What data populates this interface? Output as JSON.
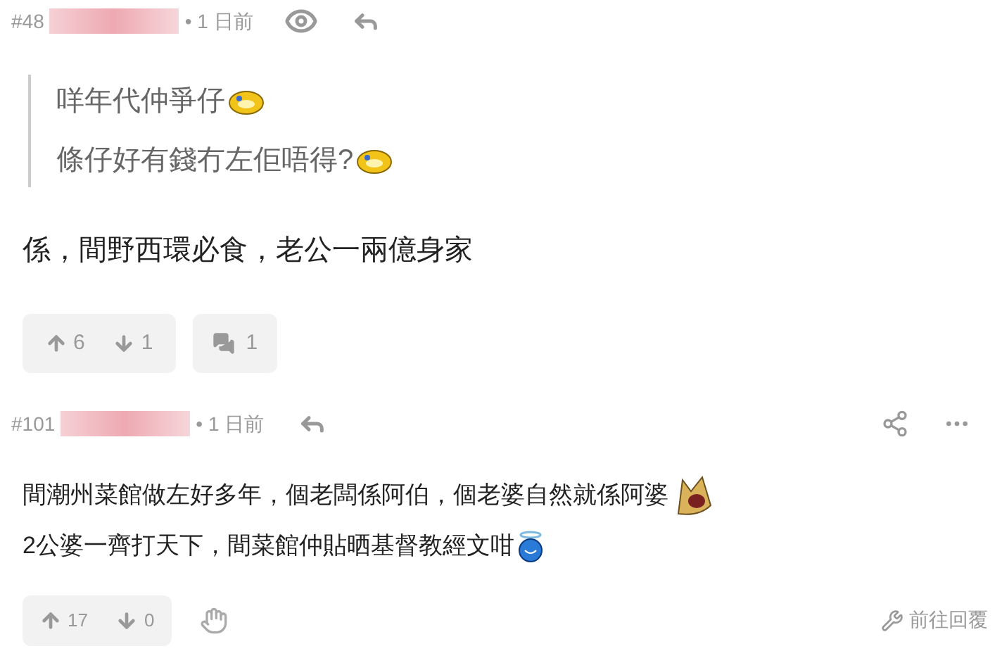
{
  "posts": [
    {
      "number": "#48",
      "time": "• 1 日前",
      "header_actions": [
        {
          "kind": "view"
        },
        {
          "kind": "reply"
        }
      ],
      "quote": [
        {
          "text": "咩年代仲爭仔",
          "kind": "sweat"
        },
        {
          "text": "條仔好有錢冇左佢唔得?",
          "kind": "sweat"
        }
      ],
      "body": [
        {
          "text": "係，間野西環必食，老公一兩億身家",
          "kind": "plain"
        }
      ],
      "upvotes": "6",
      "downvotes": "1",
      "replies": "1"
    },
    {
      "number": "#101",
      "time": "• 1 日前",
      "header_actions": [
        {
          "kind": "reply"
        },
        {
          "kind": "share"
        },
        {
          "kind": "more"
        }
      ],
      "body": [
        {
          "text": "間潮州菜館做左好多年，個老闆係阿伯，個老婆自然就係阿婆",
          "kind": "shout"
        },
        {
          "text": "2公婆一齊打天下，間菜館仲貼晒基督教經文咁",
          "kind": "angel"
        }
      ],
      "upvotes": "17",
      "downvotes": "0",
      "goto_label": "前往回覆"
    }
  ]
}
